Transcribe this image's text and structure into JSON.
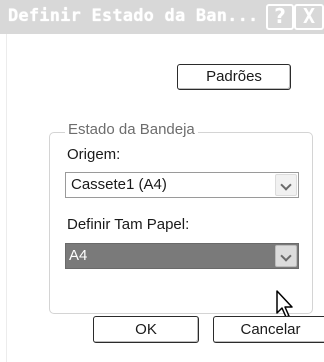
{
  "window": {
    "title": "Definir Estado da Ban...",
    "help_label": "?",
    "close_label": "X"
  },
  "buttons": {
    "defaults_label": "Padrões",
    "ok_label": "OK",
    "cancel_label": "Cancelar"
  },
  "tray_group": {
    "label": "Estado da Bandeja",
    "origin_label": "Origem:",
    "origin_value": "Cassete1 (A4)",
    "papersize_label": "Definir Tam Papel:",
    "papersize_value": "A4"
  },
  "icons": {
    "dropdown": "chevron-down-icon",
    "cursor": "mouse-pointer-icon"
  }
}
